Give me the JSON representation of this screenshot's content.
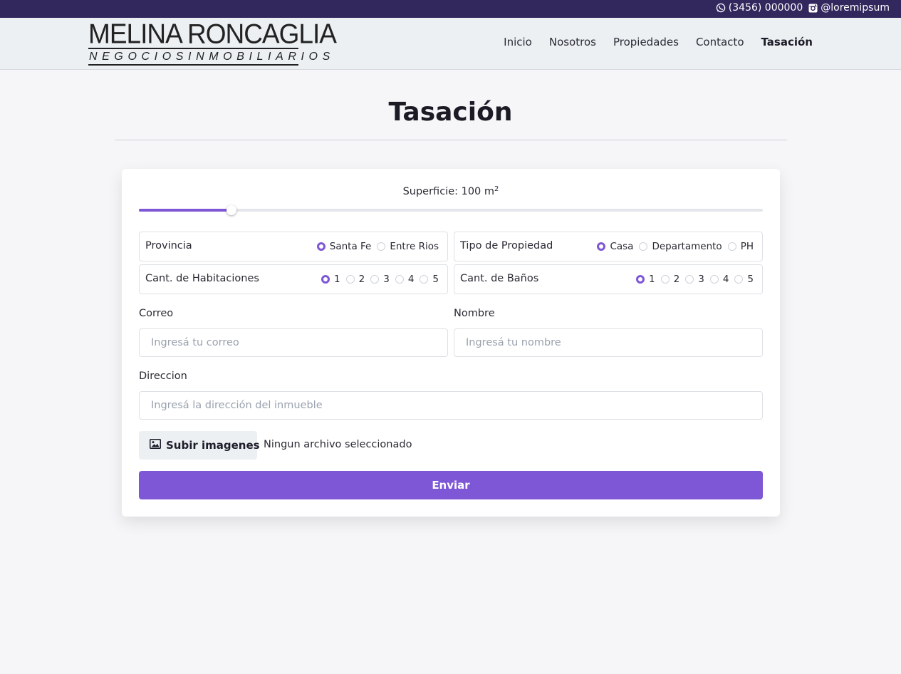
{
  "topbar": {
    "phone": "(3456) 000000",
    "instagram": "@loremipsum",
    "background": "#33285e"
  },
  "logo": {
    "name": "MELINA RONCAGLIA",
    "tagline": "NEGOCIOSINMOBILIARIOS"
  },
  "nav": {
    "items": [
      {
        "label": "Inicio"
      },
      {
        "label": "Nosotros"
      },
      {
        "label": "Propiedades"
      },
      {
        "label": "Contacto"
      },
      {
        "label": "Tasación",
        "active": true
      }
    ]
  },
  "page": {
    "title": "Tasación"
  },
  "form": {
    "surface": {
      "label": "Superficie: 100 m",
      "unit_exponent": "2",
      "value": 100,
      "fill_fraction": 0.148
    },
    "provincia": {
      "label": "Provincia",
      "options": [
        "Santa Fe",
        "Entre Rios"
      ],
      "selected": "Santa Fe"
    },
    "tipo": {
      "label": "Tipo de Propiedad",
      "options": [
        "Casa",
        "Departamento",
        "PH"
      ],
      "selected": "Casa"
    },
    "habitaciones": {
      "label": "Cant. de Habitaciones",
      "options": [
        "1",
        "2",
        "3",
        "4",
        "5"
      ],
      "selected": "1"
    },
    "banos": {
      "label": "Cant. de Baños",
      "options": [
        "1",
        "2",
        "3",
        "4",
        "5"
      ],
      "selected": "1"
    },
    "correo": {
      "label": "Correo",
      "placeholder": "Ingresá tu correo",
      "value": ""
    },
    "nombre": {
      "label": "Nombre",
      "placeholder": "Ingresá tu nombre",
      "value": ""
    },
    "direccion": {
      "label": "Direccion",
      "placeholder": "Ingresá la dirección del inmueble",
      "value": ""
    },
    "upload": {
      "button_label": "Subir imagenes",
      "icon": "image-icon",
      "status": "Ningun archivo seleccionado"
    },
    "submit_label": "Enviar",
    "accent": "#7e57d6"
  }
}
